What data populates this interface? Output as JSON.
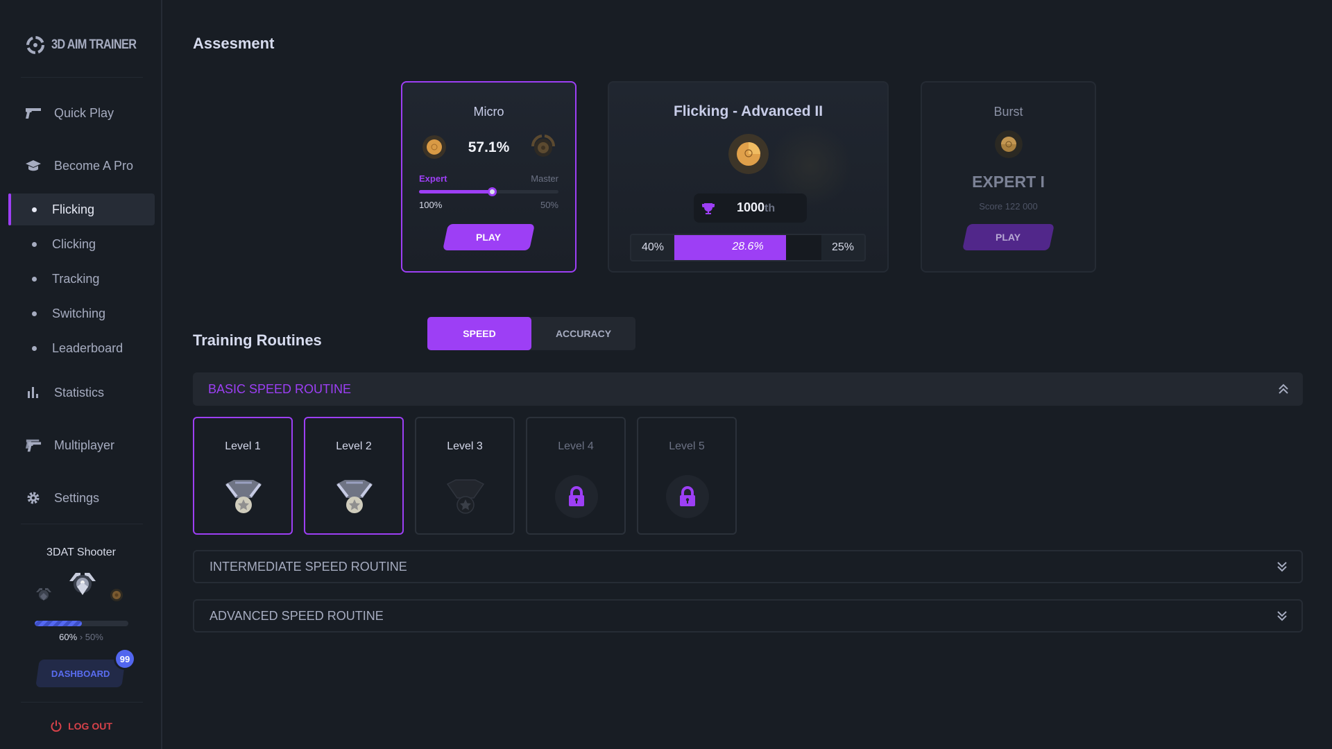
{
  "app": {
    "logo_text": "3D AIM TRAINER"
  },
  "sidebar": {
    "nav": [
      {
        "label": "Quick Play",
        "icon": "pistol-icon"
      },
      {
        "label": "Become A Pro",
        "icon": "graduation-cap-icon"
      }
    ],
    "sub_items": [
      {
        "label": "Flicking",
        "active": true
      },
      {
        "label": "Clicking",
        "active": false
      },
      {
        "label": "Tracking",
        "active": false
      },
      {
        "label": "Switching",
        "active": false
      },
      {
        "label": "Leaderboard",
        "active": false
      }
    ],
    "nav_bottom": [
      {
        "label": "Statistics",
        "icon": "bar-chart-icon"
      },
      {
        "label": "Multiplayer",
        "icon": "dual-pistols-icon"
      },
      {
        "label": "Settings",
        "icon": "gear-icon"
      }
    ],
    "profile": {
      "name": "3DAT Shooter",
      "xp_progress": 0.5,
      "xp_current": "60%",
      "xp_separator": "›",
      "xp_next": "50%",
      "dashboard_label": "DASHBOARD",
      "notification_count": "99"
    },
    "logout_label": "LOG OUT"
  },
  "assessment": {
    "title": "Assesment",
    "micro": {
      "title": "Micro",
      "percent": "57.1%",
      "left_tier": "Expert",
      "right_tier": "Master",
      "left_value": "100%",
      "right_value": "50%",
      "slider_progress": 0.52,
      "play_label": "PLAY"
    },
    "flicking": {
      "title": "Flicking - Advanced II",
      "rank": "1000",
      "rank_suffix": "th",
      "left_value": "40%",
      "bar_value": "28.6%",
      "bar_progress": 0.76,
      "right_value": "25%"
    },
    "burst": {
      "title": "Burst",
      "tier": "EXPERT I",
      "score": "Score 122 000",
      "play_label": "PLAY"
    }
  },
  "training": {
    "title": "Training Routines",
    "tabs": [
      {
        "label": "SPEED",
        "active": true
      },
      {
        "label": "ACCURACY",
        "active": false
      }
    ],
    "routines": [
      {
        "label": "BASIC SPEED ROUTINE",
        "expanded": true
      },
      {
        "label": "INTERMEDIATE SPEED ROUTINE",
        "expanded": false
      },
      {
        "label": "ADVANCED SPEED ROUTINE",
        "expanded": false
      }
    ],
    "levels": [
      {
        "label": "Level 1",
        "state": "completed",
        "icon": "silver-medal-icon"
      },
      {
        "label": "Level 2",
        "state": "completed",
        "icon": "silver-medal-icon"
      },
      {
        "label": "Level 3",
        "state": "unlocked",
        "icon": "dark-medal-icon"
      },
      {
        "label": "Level 4",
        "state": "locked",
        "icon": "lock-icon"
      },
      {
        "label": "Level 5",
        "state": "locked",
        "icon": "lock-icon"
      }
    ]
  },
  "colors": {
    "accent": "#9d3ff5",
    "background": "#181d24",
    "dashboard_blue": "#5266ef",
    "logout_red": "#d8424a"
  }
}
